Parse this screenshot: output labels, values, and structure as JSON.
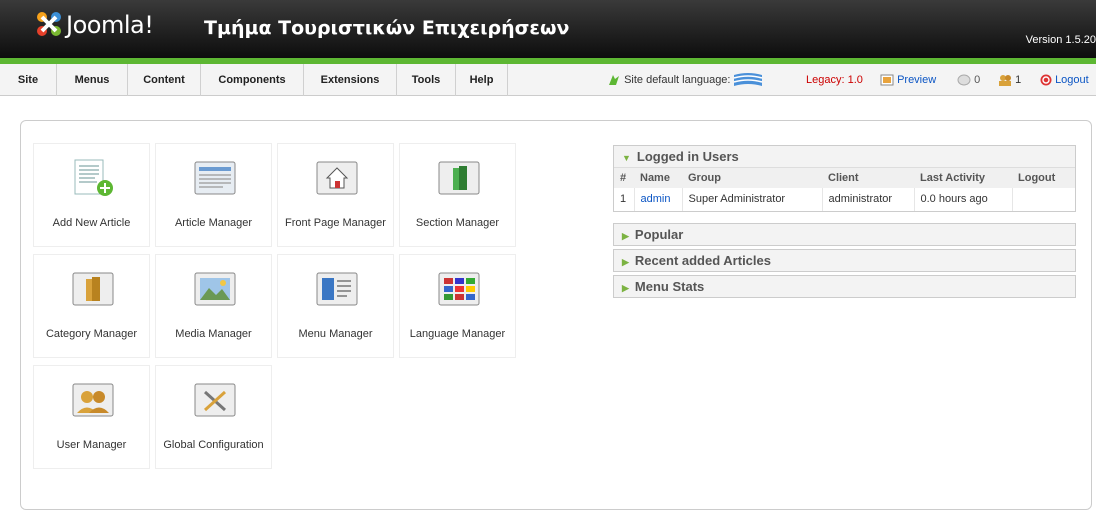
{
  "header": {
    "brand": "Joomla!",
    "site_title": "Τμήμα Τουριστικών Επιχειρήσεων",
    "version": "Version 1.5.20"
  },
  "menu": {
    "items": [
      "Site",
      "Menus",
      "Content",
      "Components",
      "Extensions",
      "Tools",
      "Help"
    ]
  },
  "status": {
    "lang_label": "Site default language:",
    "legacy": "Legacy: 1.0",
    "preview": "Preview",
    "messages": "0",
    "users_online": "1",
    "logout": "Logout"
  },
  "cpanel": [
    {
      "label": "Add New Article",
      "icon": "add-article-icon"
    },
    {
      "label": "Article Manager",
      "icon": "article-manager-icon"
    },
    {
      "label": "Front Page Manager",
      "icon": "frontpage-icon"
    },
    {
      "label": "Section Manager",
      "icon": "section-icon"
    },
    {
      "label": "Category Manager",
      "icon": "category-icon"
    },
    {
      "label": "Media Manager",
      "icon": "media-icon"
    },
    {
      "label": "Menu Manager",
      "icon": "menu-icon"
    },
    {
      "label": "Language Manager",
      "icon": "language-icon"
    },
    {
      "label": "User Manager",
      "icon": "user-icon"
    },
    {
      "label": "Global Configuration",
      "icon": "config-icon"
    }
  ],
  "modules": {
    "logged_in": {
      "title": "Logged in Users",
      "columns": [
        "#",
        "Name",
        "Group",
        "Client",
        "Last Activity",
        "Logout"
      ],
      "rows": [
        {
          "num": "1",
          "name": "admin",
          "group": "Super Administrator",
          "client": "administrator",
          "activity": "0.0 hours ago"
        }
      ]
    },
    "popular": "Popular",
    "recent": "Recent added Articles",
    "menu_stats": "Menu Stats"
  },
  "colors": {
    "accent": "#5db733",
    "link": "#0b55c4",
    "legacy": "#cc0000"
  }
}
